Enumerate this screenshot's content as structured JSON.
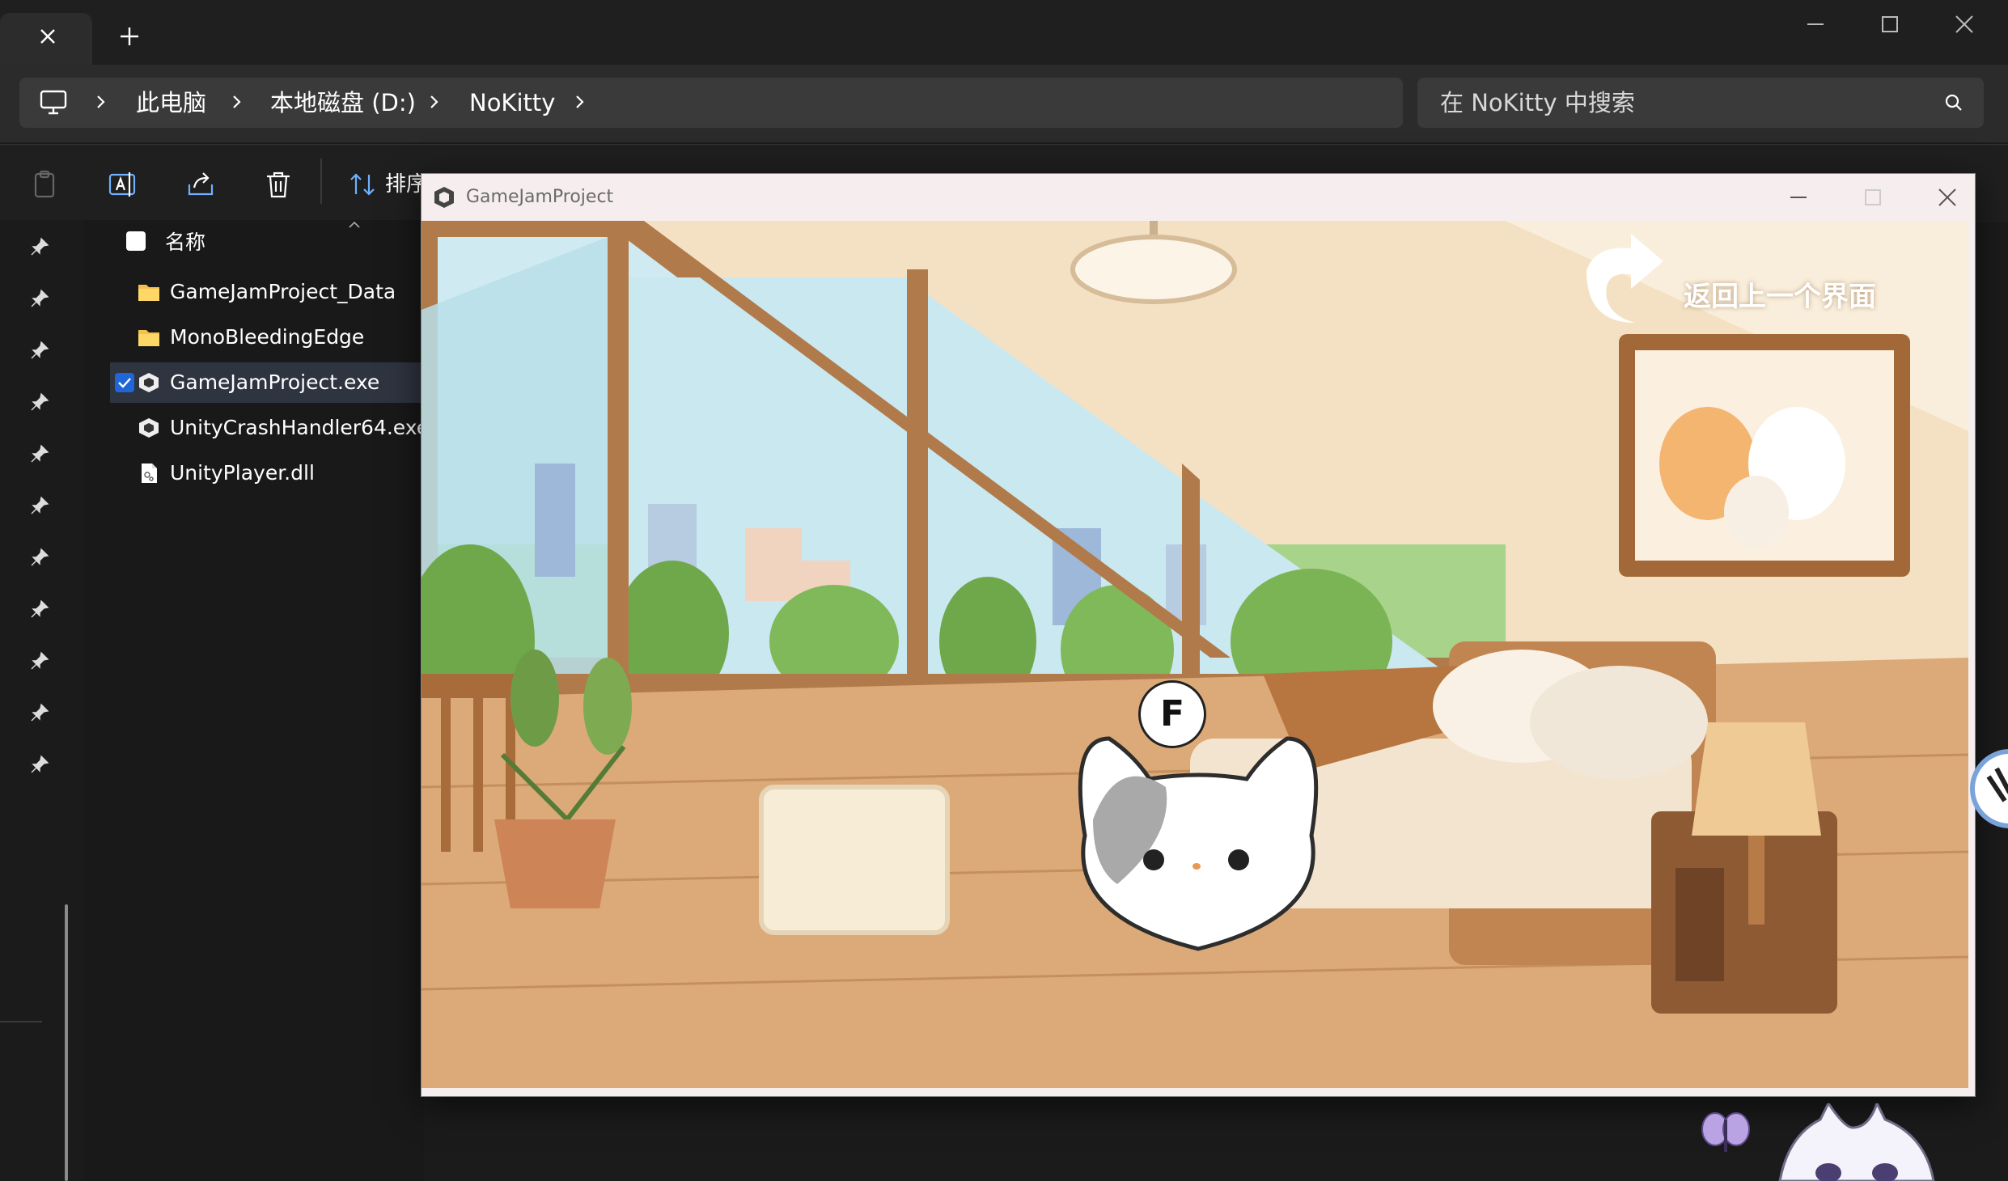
{
  "explorer": {
    "tab": {
      "close_label": "×"
    },
    "new_tab_label": "+",
    "breadcrumb": [
      "此电脑",
      "本地磁盘 (D:)",
      "NoKitty"
    ],
    "search": {
      "placeholder": "在 NoKitty 中搜索"
    },
    "toolbar": {
      "sort_label": "排序"
    },
    "list": {
      "header_name": "名称",
      "items": [
        {
          "name": "GameJamProject_Data",
          "type": "folder"
        },
        {
          "name": "MonoBleedingEdge",
          "type": "folder"
        },
        {
          "name": "GameJamProject.exe",
          "type": "unity-exe",
          "selected": true
        },
        {
          "name": "UnityCrashHandler64.exe",
          "type": "unity-exe"
        },
        {
          "name": "UnityPlayer.dll",
          "type": "dll"
        }
      ]
    }
  },
  "game_window": {
    "title": "GameJamProject",
    "back_button_label": "返回上一个界面",
    "interact_key": "F"
  },
  "colors": {
    "explorer_bg": "#1b1b1b",
    "game_titlebar": "#f6eeee",
    "scene_wall": "#f4e1c4",
    "floor": "#d9a877",
    "selection": "#2e3440",
    "check_blue": "#1f66d6"
  }
}
